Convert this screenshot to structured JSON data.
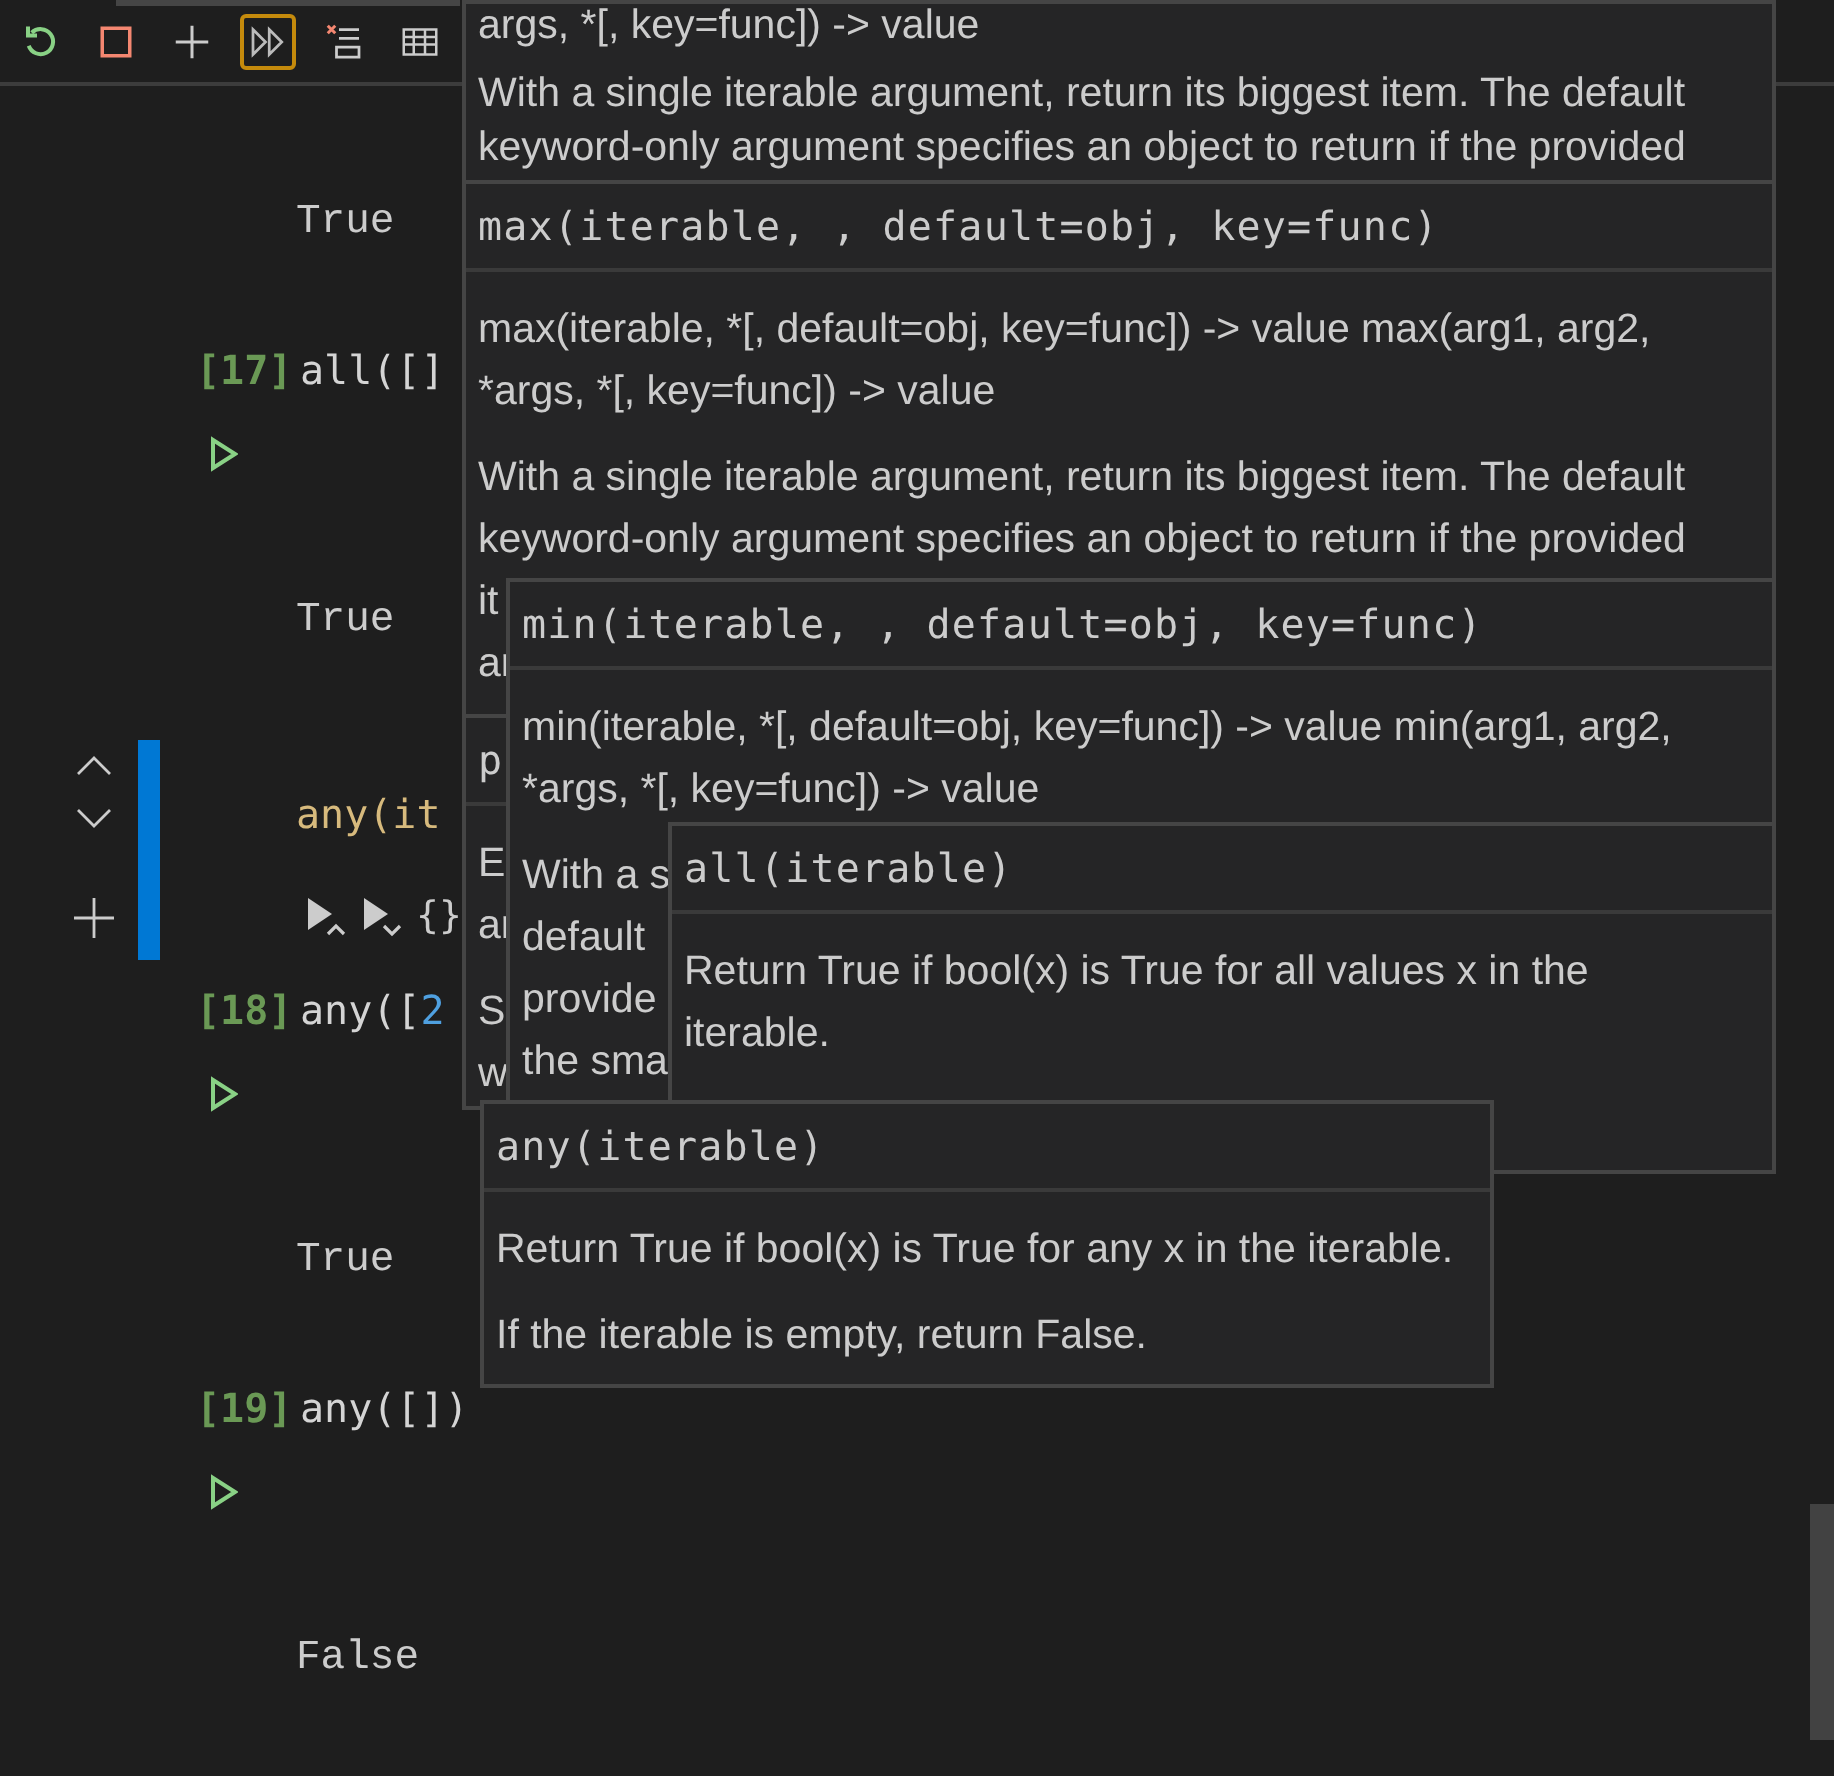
{
  "toolbar": [
    {
      "kind": "restart",
      "focused": false
    },
    {
      "kind": "stop",
      "focused": false
    },
    {
      "kind": "add",
      "focused": false
    },
    {
      "kind": "run-all",
      "focused": true
    },
    {
      "kind": "clear-outputs",
      "focused": false
    },
    {
      "kind": "variables",
      "focused": false
    }
  ],
  "cells": [
    {
      "kind": "output",
      "text": "True"
    },
    {
      "kind": "code",
      "count": "[17]",
      "focused": false,
      "runnable": true,
      "tokens": [
        {
          "color": "#d4d4d4",
          "text": "all([]"
        }
      ]
    },
    {
      "kind": "output",
      "text": "True"
    },
    {
      "kind": "code",
      "focused": true,
      "runnable": false,
      "tokens": [
        {
          "color": "#d7ba7d",
          "text": "any(it"
        }
      ],
      "cell_toolbar": "{}"
    },
    {
      "kind": "code",
      "count": "[18]",
      "focused": false,
      "runnable": true,
      "tokens": [
        {
          "color": "#d4d4d4",
          "text": "any(["
        },
        {
          "color": "#4fa0e0",
          "text": "2"
        }
      ]
    },
    {
      "kind": "output",
      "text": "True"
    },
    {
      "kind": "code",
      "count": "[19]",
      "focused": false,
      "runnable": true,
      "tokens": [
        {
          "color": "#d4d4d4",
          "text": "any([])"
        }
      ]
    },
    {
      "kind": "output",
      "text": "False"
    }
  ],
  "hovers": [
    {
      "paragraphs": [
        [
          "args, *[, key=func]) -> value"
        ],
        [
          "With a single iterable argument, return its biggest item. The default",
          "keyword-only argument specifies an object to return if the provided"
        ]
      ]
    },
    {
      "header": "max(iterable, , default=obj, key=func)",
      "paragraphs": [
        [
          "max(iterable, *[, default=obj, key=func]) -> value max(arg1, arg2,",
          "*args, *[, key=func]) -> value"
        ],
        [
          "With a single iterable argument, return its biggest item. The default",
          "keyword-only argument specifies an object to return if the provided",
          "it",
          "ar"
        ]
      ]
    },
    {
      "header": "p",
      "paragraphs": [
        [
          "E",
          "ar"
        ],
        [
          "S",
          "w"
        ]
      ]
    },
    {
      "header": "min(iterable, , default=obj, key=func)",
      "paragraphs": [
        [
          "min(iterable, *[, default=obj, key=func]) -> value min(arg1, arg2,",
          "*args, *[, key=func]) -> value"
        ],
        [
          "With a s",
          "default",
          "provide",
          "the sma"
        ]
      ]
    },
    {
      "header": "all(iterable)",
      "paragraphs": [
        [
          "Return True if bool(x) is True for all values x in the",
          "iterable."
        ]
      ]
    },
    {
      "header": "any(iterable)",
      "paragraphs": [
        [
          "Return True if bool(x) is True for any x in the iterable."
        ],
        [
          "If the iterable is empty, return False."
        ]
      ]
    }
  ]
}
